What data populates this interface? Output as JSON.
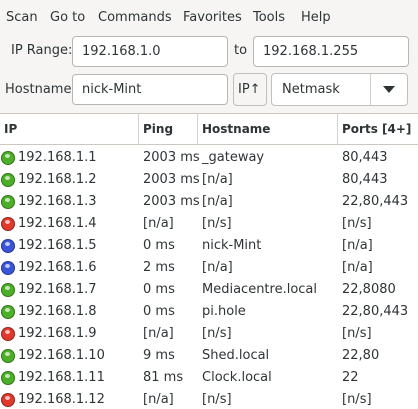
{
  "menu": [
    "Scan",
    "Go to",
    "Commands",
    "Favorites",
    "Tools",
    "Help"
  ],
  "range": {
    "label": "IP Range:",
    "from": "192.168.1.0",
    "to_label": "to",
    "to": "192.168.1.255"
  },
  "host": {
    "label": "Hostname:",
    "value": "nick-Mint",
    "ip_button": "IP↑",
    "mask": "Netmask"
  },
  "columns": [
    "IP",
    "Ping",
    "Hostname",
    "Ports [4+]"
  ],
  "colors": {
    "alive": "#4caf28",
    "dead": "#e0382c",
    "up": "#3b55d9"
  },
  "rows": [
    {
      "status": "alive",
      "ip": "192.168.1.1",
      "ping": "2003 ms",
      "host": "_gateway",
      "ports": "80,443"
    },
    {
      "status": "alive",
      "ip": "192.168.1.2",
      "ping": "2003 ms",
      "host": "[n/a]",
      "ports": "80,443"
    },
    {
      "status": "alive",
      "ip": "192.168.1.3",
      "ping": "2003 ms",
      "host": "[n/a]",
      "ports": "22,80,443"
    },
    {
      "status": "dead",
      "ip": "192.168.1.4",
      "ping": "[n/a]",
      "host": "[n/s]",
      "ports": "[n/s]"
    },
    {
      "status": "up",
      "ip": "192.168.1.5",
      "ping": "0 ms",
      "host": "nick-Mint",
      "ports": "[n/a]"
    },
    {
      "status": "up",
      "ip": "192.168.1.6",
      "ping": "2 ms",
      "host": "[n/a]",
      "ports": "[n/a]"
    },
    {
      "status": "alive",
      "ip": "192.168.1.7",
      "ping": "0 ms",
      "host": "Mediacentre.local",
      "ports": "22,8080"
    },
    {
      "status": "alive",
      "ip": "192.168.1.8",
      "ping": "0 ms",
      "host": "pi.hole",
      "ports": "22,80,443"
    },
    {
      "status": "dead",
      "ip": "192.168.1.9",
      "ping": "[n/a]",
      "host": "[n/s]",
      "ports": "[n/s]"
    },
    {
      "status": "alive",
      "ip": "192.168.1.10",
      "ping": "9 ms",
      "host": "Shed.local",
      "ports": "22,80"
    },
    {
      "status": "alive",
      "ip": "192.168.1.11",
      "ping": "81 ms",
      "host": "Clock.local",
      "ports": "22"
    },
    {
      "status": "dead",
      "ip": "192.168.1.12",
      "ping": "[n/a]",
      "host": "[n/s]",
      "ports": "[n/s]"
    }
  ]
}
